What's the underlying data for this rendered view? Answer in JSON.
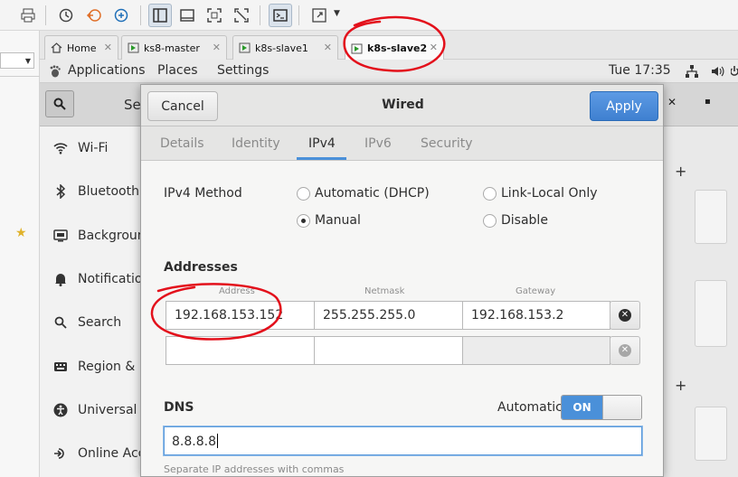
{
  "toolbar": {
    "icons": [
      "print-icon",
      "snapshot-icon",
      "revert-snapshot-icon",
      "snapshot-manager-icon",
      "sidebar-view-icon",
      "console-view-icon",
      "fullscreen-icon",
      "unity-icon",
      "terminal-icon",
      "stretch-icon"
    ]
  },
  "vm_tabs": [
    {
      "label": "Home",
      "icon": "home-icon",
      "active": false
    },
    {
      "label": "ks8-master",
      "icon": "vm-icon",
      "active": false
    },
    {
      "label": "k8s-slave1",
      "icon": "vm-icon",
      "active": false
    },
    {
      "label": "k8s-slave2",
      "icon": "vm-icon",
      "active": true
    }
  ],
  "gnome_bar": {
    "applications": "Applications",
    "places": "Places",
    "settings": "Settings",
    "clock": "Tue 17:35"
  },
  "settings": {
    "title_fragment": "Se",
    "sidebar": [
      {
        "label": "Wi-Fi",
        "icon": "wifi-icon"
      },
      {
        "label": "Bluetooth",
        "icon": "bluetooth-icon"
      },
      {
        "label": "Background",
        "icon": "background-icon"
      },
      {
        "label": "Notifications",
        "icon": "bell-icon"
      },
      {
        "label": "Search",
        "icon": "search-icon"
      },
      {
        "label": "Region & Language",
        "icon": "keyboard-icon"
      },
      {
        "label": "Universal Access",
        "icon": "accessibility-icon"
      },
      {
        "label": "Online Accounts",
        "icon": "online-accounts-icon"
      }
    ]
  },
  "dialog": {
    "title": "Wired",
    "cancel_label": "Cancel",
    "apply_label": "Apply",
    "tabs": [
      "Details",
      "Identity",
      "IPv4",
      "IPv6",
      "Security"
    ],
    "active_tab": "IPv4",
    "ipv4_method_label": "IPv4 Method",
    "methods": [
      {
        "label": "Automatic (DHCP)",
        "selected": false
      },
      {
        "label": "Link-Local Only",
        "selected": false
      },
      {
        "label": "Manual",
        "selected": true
      },
      {
        "label": "Disable",
        "selected": false
      }
    ],
    "addresses_label": "Addresses",
    "columns": [
      "Address",
      "Netmask",
      "Gateway"
    ],
    "rows": [
      {
        "address": "192.168.153.152",
        "netmask": "255.255.255.0",
        "gateway": "192.168.153.2"
      },
      {
        "address": "",
        "netmask": "",
        "gateway": ""
      }
    ],
    "dns_label": "DNS",
    "dns_automatic_label": "Automatic",
    "dns_toggle": "ON",
    "dns_value": "8.8.8.8",
    "dns_hint": "Separate IP addresses with commas"
  },
  "colors": {
    "accent": "#4a90d9",
    "annotation": "#e3101b"
  }
}
